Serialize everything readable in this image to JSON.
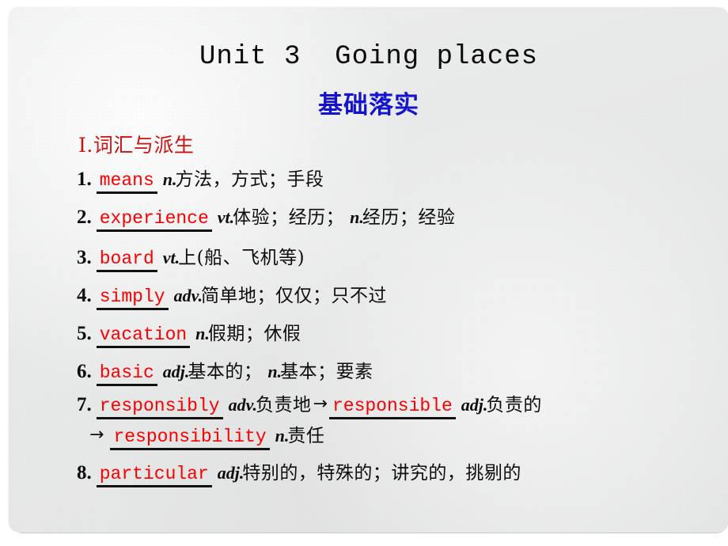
{
  "slide": {
    "title": "Unit 3  Going places",
    "subtitle": "基础落实",
    "section_heading": "Ⅰ.词汇与派生",
    "colors": {
      "title_black": "#0a0a0a",
      "subtitle_blue": "#1414cd",
      "heading_red": "#cc1111",
      "answer_red": "#fb0000",
      "background_gray": "#e7e8e8"
    }
  },
  "vocab": {
    "items": [
      {
        "number": "1.",
        "answer": "means",
        "pos": "n.",
        "definition": "方法，方式；手段"
      },
      {
        "number": "2.",
        "answer": "experience",
        "pos": "vt.",
        "definition": "体验；经历；",
        "pos2": "n.",
        "definition2": "经历；经验"
      },
      {
        "number": "3.",
        "answer": "board",
        "pos": "vt.",
        "definition": "上(船、飞机等)"
      },
      {
        "number": "4.",
        "answer": "simply",
        "pos": "adv.",
        "definition": "简单地；仅仅；只不过"
      },
      {
        "number": "5.",
        "answer": "vacation",
        "pos": "n.",
        "definition": "假期；休假"
      },
      {
        "number": "6.",
        "answer": "basic",
        "pos": "adj.",
        "definition": "基本的；",
        "pos2": "n.",
        "definition2": "基本；要素"
      },
      {
        "number": "7.",
        "answer": "responsibly",
        "pos": "adv.",
        "definition": "负责地",
        "arrow": "→",
        "answer2": "responsible",
        "pos2": "adj.",
        "definition2": "负责的",
        "arrow2": "→",
        "answer3": "responsibility",
        "pos3": "n.",
        "definition3": "责任"
      },
      {
        "number": "8.",
        "answer": "particular",
        "pos": "adj.",
        "definition": "特别的，特殊的；讲究的，挑剔的"
      }
    ]
  }
}
